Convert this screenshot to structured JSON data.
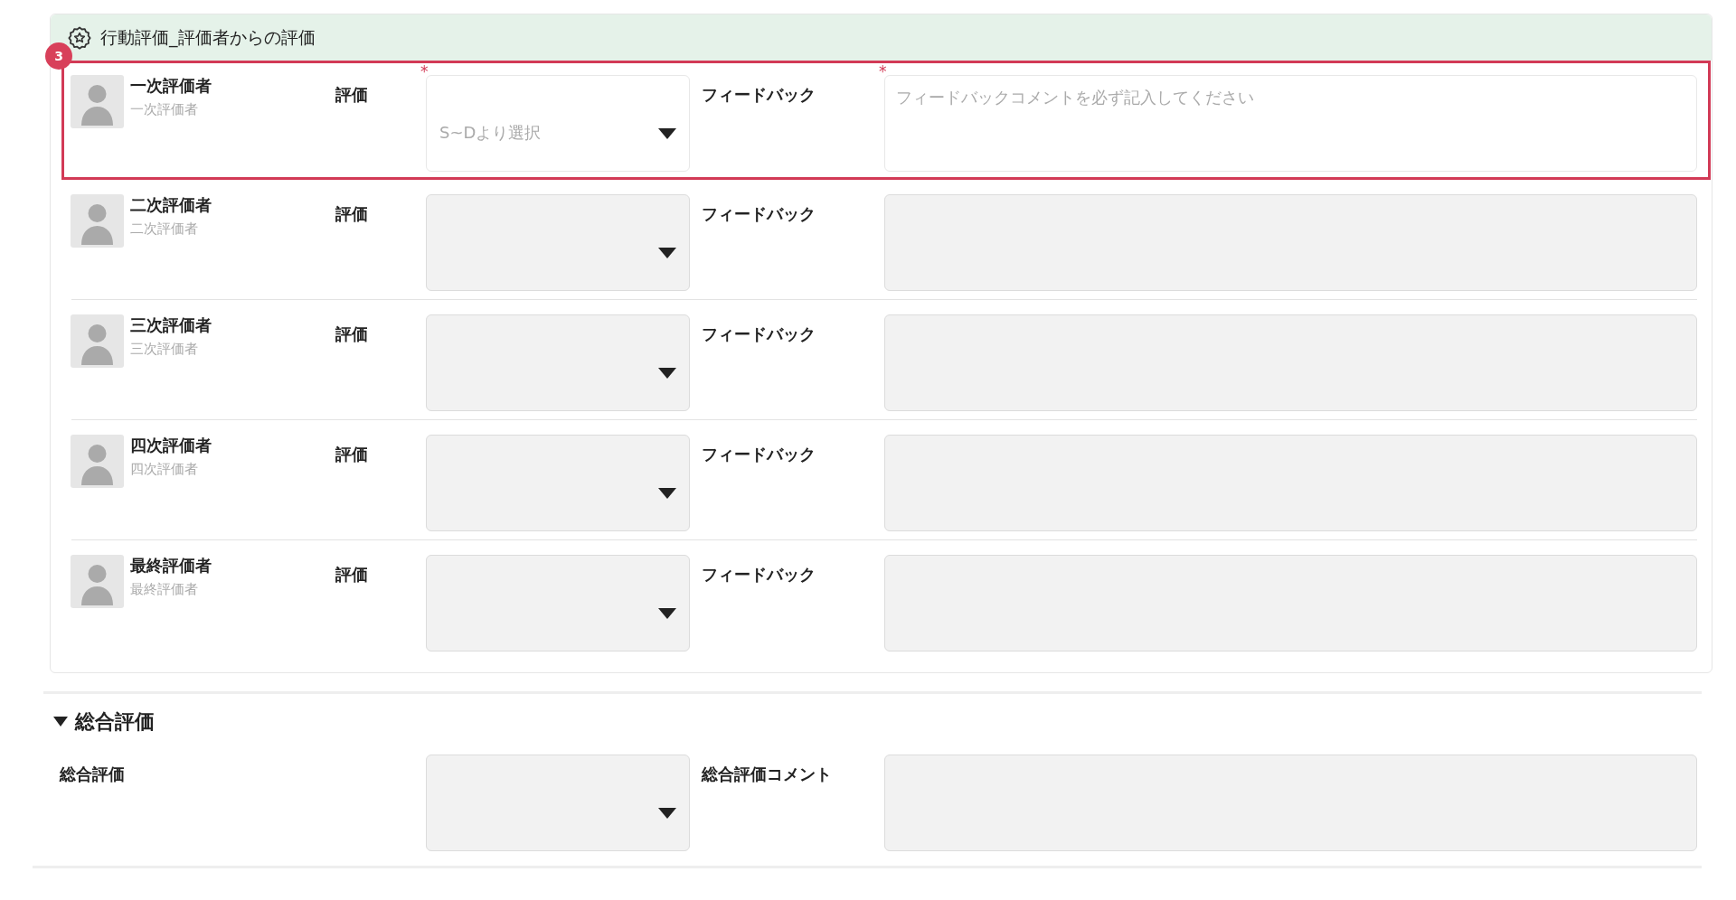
{
  "section": {
    "title": "行動評価_評価者からの評価",
    "step_badge": "3"
  },
  "evaluators": [
    {
      "name": "一次評価者",
      "role": "一次評価者",
      "highlighted": true,
      "rating_label": "評価",
      "rating": {
        "placeholder": "S~Dより選択",
        "disabled": false,
        "required_mark": "*"
      },
      "feedback_label": "フィードバック",
      "feedback": {
        "placeholder": "フィードバックコメントを必ず記入してください",
        "disabled": false,
        "required_mark": "*"
      }
    },
    {
      "name": "二次評価者",
      "role": "二次評価者",
      "highlighted": false,
      "rating_label": "評価",
      "rating": {
        "disabled": true
      },
      "feedback_label": "フィードバック",
      "feedback": {
        "disabled": true
      }
    },
    {
      "name": "三次評価者",
      "role": "三次評価者",
      "highlighted": false,
      "rating_label": "評価",
      "rating": {
        "disabled": true
      },
      "feedback_label": "フィードバック",
      "feedback": {
        "disabled": true
      }
    },
    {
      "name": "四次評価者",
      "role": "四次評価者",
      "highlighted": false,
      "rating_label": "評価",
      "rating": {
        "disabled": true
      },
      "feedback_label": "フィードバック",
      "feedback": {
        "disabled": true
      }
    },
    {
      "name": "最終評価者",
      "role": "最終評価者",
      "highlighted": false,
      "rating_label": "評価",
      "rating": {
        "disabled": true
      },
      "feedback_label": "フィードバック",
      "feedback": {
        "disabled": true
      }
    }
  ],
  "overall": {
    "title": "総合評価",
    "expanded": true,
    "rating_label": "総合評価",
    "rating": {
      "disabled": true
    },
    "comment_label": "総合評価コメント",
    "comment": {
      "disabled": true
    }
  }
}
